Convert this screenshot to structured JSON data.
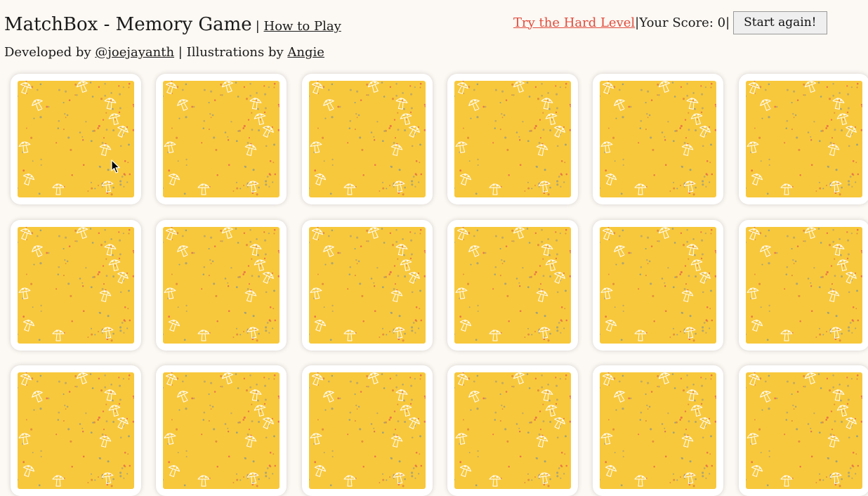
{
  "header": {
    "title": "MatchBox - Memory Game",
    "separator": "|",
    "how_to_play": "How to Play",
    "developed_by": "Developed by",
    "developer_handle": "@joejayanth",
    "illustrations_by": "Illustrations by",
    "illustrator": "Angie"
  },
  "status": {
    "hard_level": "Try the Hard Level",
    "score_text": "Your Score: 0",
    "separator": "|",
    "restart_label": "Start again!"
  },
  "board": {
    "rows": 3,
    "cols": 6,
    "card_face": "face-down",
    "card_back_icon": "mushroom-pattern-icon",
    "colors": {
      "card_back": "#f8c83c",
      "card_frame": "#ffffff",
      "page": "#fcf8f3",
      "hard_link": "#e14b3c",
      "dots": [
        "#e0873c",
        "#b9a66a",
        "#8f9e86",
        "#e86b4a",
        "#a3a07a"
      ]
    }
  }
}
